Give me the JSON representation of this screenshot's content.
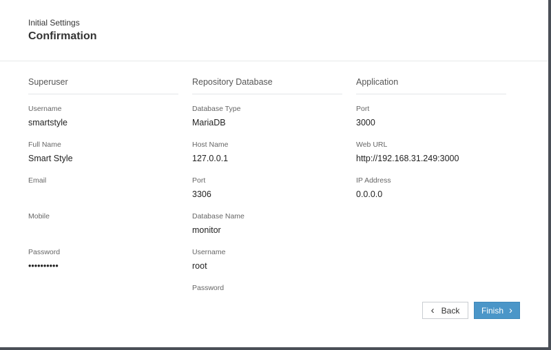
{
  "header": {
    "subtitle": "Initial Settings",
    "title": "Confirmation"
  },
  "superuser": {
    "heading": "Superuser",
    "fields": [
      {
        "label": "Username",
        "value": "smartstyle"
      },
      {
        "label": "Full Name",
        "value": "Smart Style"
      },
      {
        "label": "Email",
        "value": ""
      },
      {
        "label": "Mobile",
        "value": ""
      },
      {
        "label": "Password",
        "value": "••••••••••"
      }
    ]
  },
  "repository": {
    "heading": "Repository Database",
    "fields": [
      {
        "label": "Database Type",
        "value": "MariaDB"
      },
      {
        "label": "Host Name",
        "value": "127.0.0.1"
      },
      {
        "label": "Port",
        "value": "3306"
      },
      {
        "label": "Database Name",
        "value": "monitor"
      },
      {
        "label": "Username",
        "value": "root"
      },
      {
        "label": "Password",
        "value": ""
      }
    ]
  },
  "application": {
    "heading": "Application",
    "fields": [
      {
        "label": "Port",
        "value": "3000"
      },
      {
        "label": "Web URL",
        "value": "http://192.168.31.249:3000"
      },
      {
        "label": "IP Address",
        "value": "0.0.0.0"
      }
    ]
  },
  "buttons": {
    "back_label": "Back",
    "finish_label": "Finish"
  },
  "colors": {
    "accent": "#4b96c8",
    "backdrop": "#4a4f57"
  }
}
